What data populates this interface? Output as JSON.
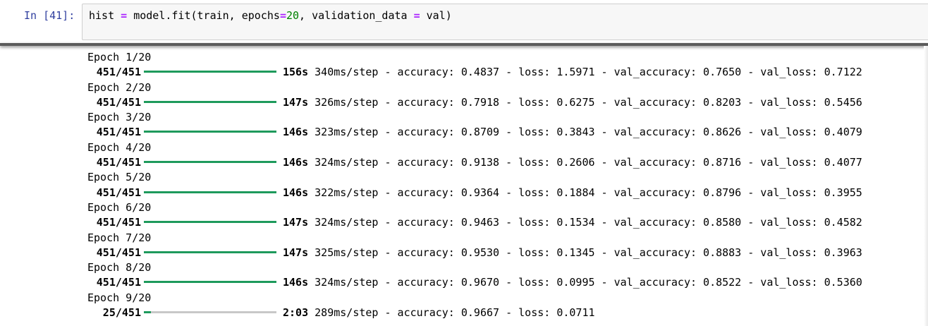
{
  "cell": {
    "prompt": "In [41]:",
    "code": {
      "lhs": "hist ",
      "eq": "=",
      "call": " model.fit(train, epochs",
      "eq2": "=",
      "num": "20",
      "rest": ", validation_data ",
      "eq3": "=",
      "tail": " val)"
    }
  },
  "output": {
    "epochs": [
      {
        "header": "Epoch 1/20",
        "steps": "451/451",
        "progress": 1.0,
        "time": "156s",
        "metrics": "340ms/step - accuracy: 0.4837 - loss: 1.5971 - val_accuracy: 0.7650 - val_loss: 0.7122"
      },
      {
        "header": "Epoch 2/20",
        "steps": "451/451",
        "progress": 1.0,
        "time": "147s",
        "metrics": "326ms/step - accuracy: 0.7918 - loss: 0.6275 - val_accuracy: 0.8203 - val_loss: 0.5456"
      },
      {
        "header": "Epoch 3/20",
        "steps": "451/451",
        "progress": 1.0,
        "time": "146s",
        "metrics": "323ms/step - accuracy: 0.8709 - loss: 0.3843 - val_accuracy: 0.8626 - val_loss: 0.4079"
      },
      {
        "header": "Epoch 4/20",
        "steps": "451/451",
        "progress": 1.0,
        "time": "146s",
        "metrics": "324ms/step - accuracy: 0.9138 - loss: 0.2606 - val_accuracy: 0.8716 - val_loss: 0.4077"
      },
      {
        "header": "Epoch 5/20",
        "steps": "451/451",
        "progress": 1.0,
        "time": "146s",
        "metrics": "322ms/step - accuracy: 0.9364 - loss: 0.1884 - val_accuracy: 0.8796 - val_loss: 0.3955"
      },
      {
        "header": "Epoch 6/20",
        "steps": "451/451",
        "progress": 1.0,
        "time": "147s",
        "metrics": "324ms/step - accuracy: 0.9463 - loss: 0.1534 - val_accuracy: 0.8580 - val_loss: 0.4582"
      },
      {
        "header": "Epoch 7/20",
        "steps": "451/451",
        "progress": 1.0,
        "time": "147s",
        "metrics": "325ms/step - accuracy: 0.9530 - loss: 0.1345 - val_accuracy: 0.8883 - val_loss: 0.3963"
      },
      {
        "header": "Epoch 8/20",
        "steps": "451/451",
        "progress": 1.0,
        "time": "146s",
        "metrics": "324ms/step - accuracy: 0.9670 - loss: 0.0995 - val_accuracy: 0.8522 - val_loss: 0.5360"
      },
      {
        "header": "Epoch 9/20",
        "steps": " 25/451",
        "progress": 0.055,
        "time": "2:03",
        "metrics": "289ms/step - accuracy: 0.9667 - loss: 0.0711"
      }
    ]
  },
  "colors": {
    "prompt": "#303f9f",
    "progress_fill": "#1e9a5c",
    "progress_track": "#c8c8c8",
    "operator": "#aa22ff",
    "number": "#008000"
  }
}
